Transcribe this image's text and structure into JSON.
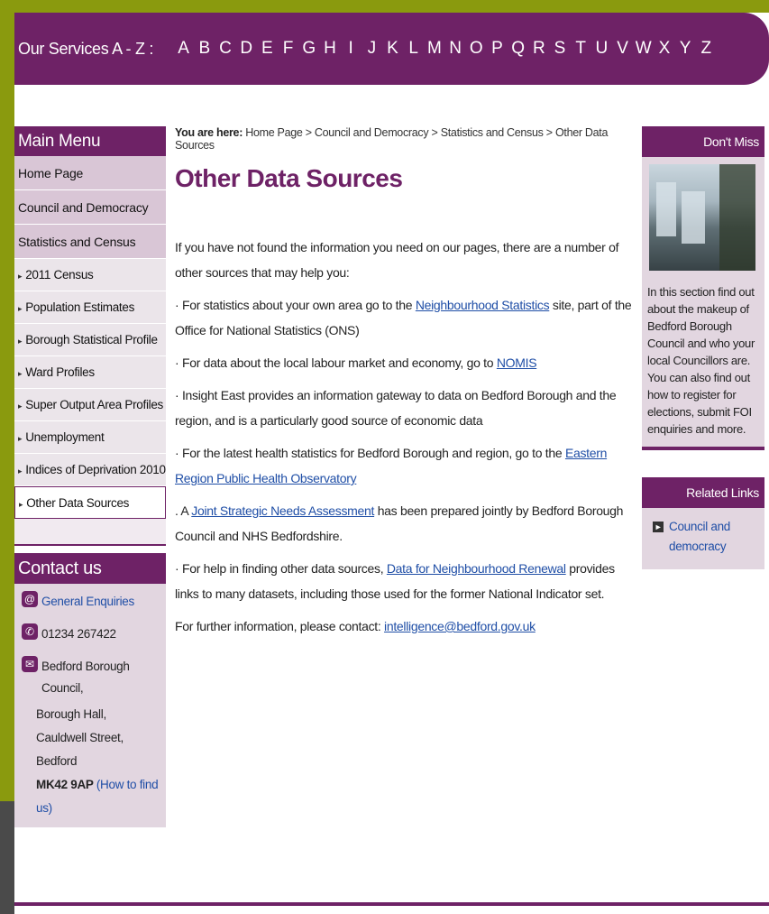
{
  "az": {
    "title": "Our Services A - Z :",
    "letters": [
      "A",
      "B",
      "C",
      "D",
      "E",
      "F",
      "G",
      "H",
      "I",
      "J",
      "K",
      "L",
      "M",
      "N",
      "O",
      "P",
      "Q",
      "R",
      "S",
      "T",
      "U",
      "V",
      "W",
      "X",
      "Y",
      "Z"
    ]
  },
  "main_menu": {
    "heading": "Main Menu",
    "items": [
      "Home Page",
      "Council and Democracy",
      "Statistics and Census"
    ],
    "sub_items": [
      "2011 Census",
      "Population Estimates",
      "Borough Statistical Profile",
      "Ward Profiles",
      "Super Output Area Profiles",
      "Unemployment",
      "Indices of Deprivation 2010",
      "Other Data Sources"
    ],
    "active_sub": "Other Data Sources"
  },
  "contact": {
    "heading": "Contact us",
    "enquiries": "General Enquiries",
    "phone": "01234 267422",
    "address_lines": [
      "Bedford Borough Council,",
      "Borough Hall,",
      "Cauldwell Street,",
      "Bedford"
    ],
    "postcode": "MK42 9AP",
    "find_us": "(How to find us)"
  },
  "breadcrumb": {
    "prefix": "You are here:",
    "items": [
      "Home Page",
      "Council and Democracy",
      "Statistics and Census",
      "Other Data Sources"
    ],
    "separator": ">"
  },
  "page": {
    "title": "Other Data Sources",
    "intro": "If you have not found the information you need on our pages, there are a number of other sources that may help you:",
    "p1_pre": "· For statistics about your own area go to the ",
    "p1_link": "Neighbourhood Statistics",
    "p1_post": " site, part of the Office for National Statistics (ONS)",
    "p2_pre": "· For data about the local labour market and economy, go to ",
    "p2_link": "NOMIS",
    "p3": "· Insight East provides an information gateway to data on Bedford Borough and the region, and is a particularly good source of economic data",
    "p4_pre": "· For the latest health statistics for Bedford Borough and region, go to the ",
    "p4_link": "Eastern Region Public Health Observatory",
    "p5_pre": ". A ",
    "p5_link": "Joint Strategic Needs Assessment",
    "p5_post": " has been prepared jointly by Bedford Borough Council and NHS Bedfordshire.",
    "p6_pre": "· For help in finding other data sources, ",
    "p6_link": "Data for Neighbourhood Renewal",
    "p6_post": " provides links to many datasets, including those used for the former National Indicator set.",
    "p7_pre": "For further information, please contact: ",
    "p7_link": "intelligence@bedford.gov.uk"
  },
  "dont_miss": {
    "heading": "Don't Miss",
    "text": "In this section find out about the makeup of Bedford Borough Council and who your local Councillors are. You can also find out how to register for elections, submit FOI enquiries and more."
  },
  "related": {
    "heading": "Related Links",
    "link": "Council and democracy"
  },
  "colors": {
    "brand_purple": "#6e2266",
    "olive": "#8a9a0e",
    "link_blue": "#1f4ea6"
  }
}
